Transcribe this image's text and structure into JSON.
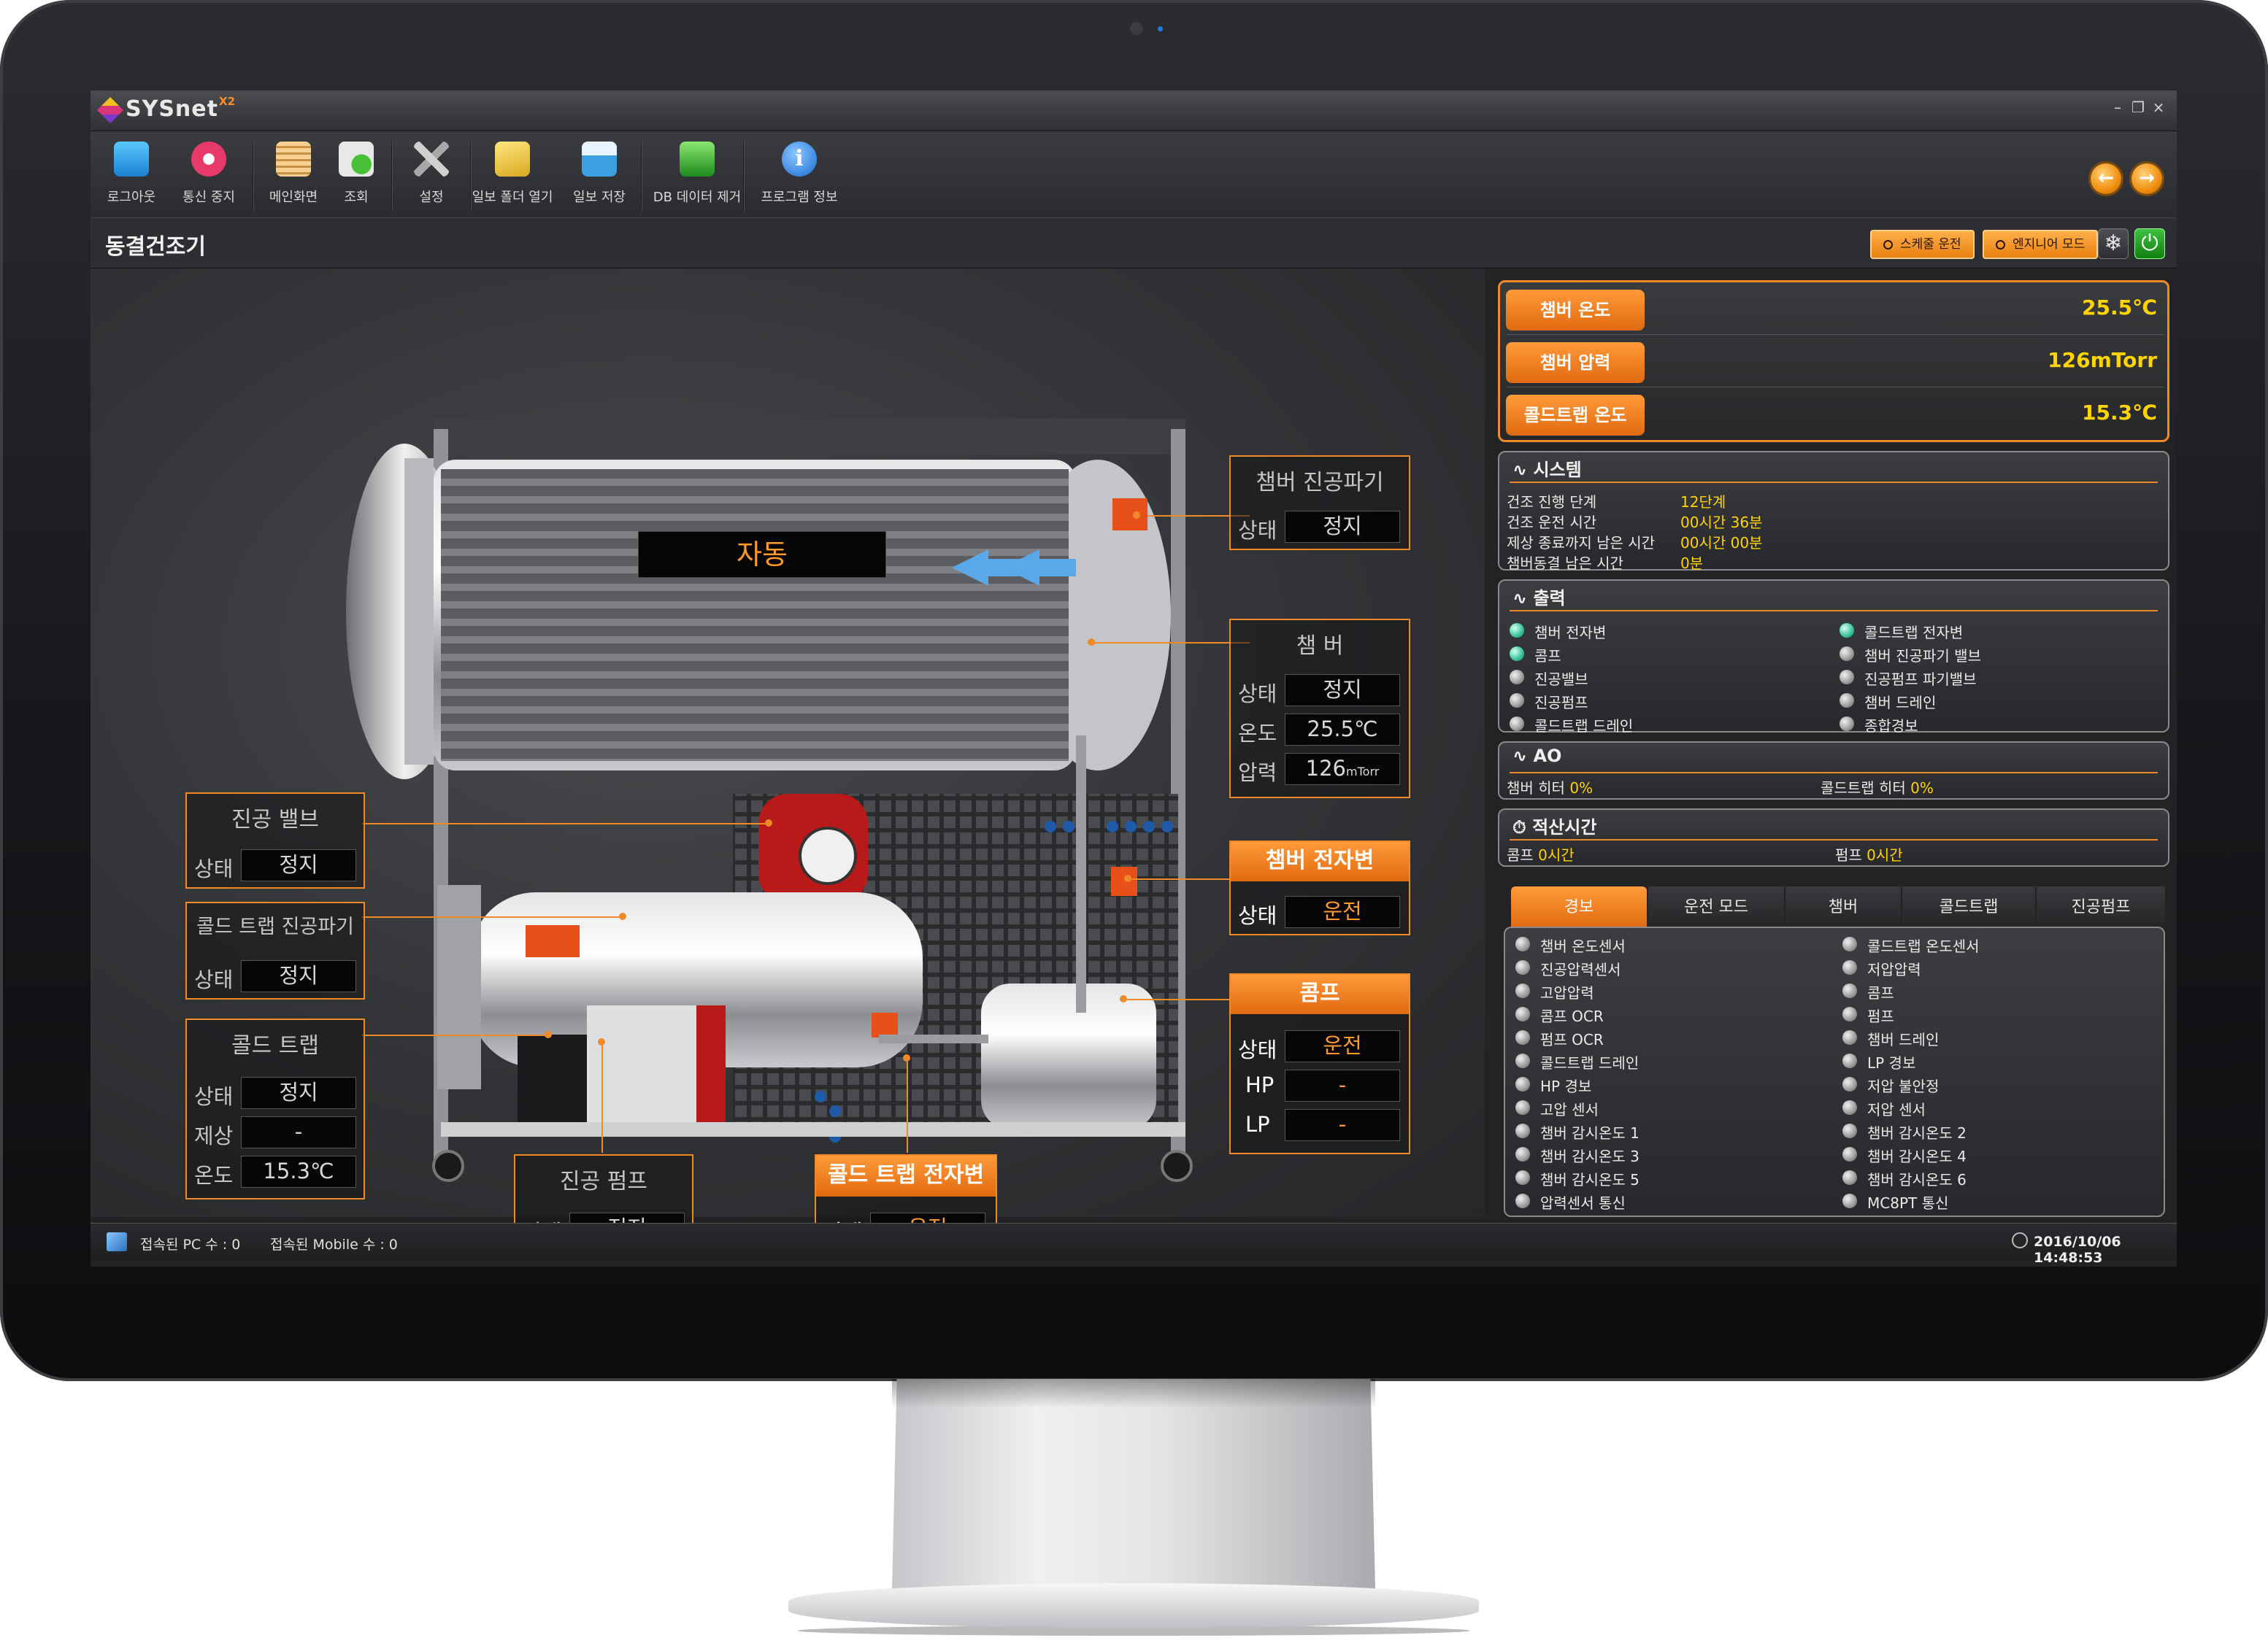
{
  "app": {
    "logo": "SYSnet",
    "logo_sup": "X2"
  },
  "toolbar": {
    "items": [
      {
        "id": "logout",
        "label": "로그아웃",
        "icon": "logout-icon",
        "color": "#2aa0e8"
      },
      {
        "id": "comm-stop",
        "label": "통신 중지",
        "icon": "stop-icon",
        "color": "#e83a6a"
      },
      {
        "id": "main",
        "label": "메인화면",
        "icon": "main-screen-icon",
        "color": "#e8a040"
      },
      {
        "id": "view",
        "label": "조회",
        "icon": "search-icon",
        "color": "#38b030"
      },
      {
        "id": "settings",
        "label": "설정",
        "icon": "tools-icon",
        "color": "#c8c8c8"
      },
      {
        "id": "open-log",
        "label": "일보 폴더 열기",
        "icon": "folder-icon",
        "color": "#e8c030"
      },
      {
        "id": "save-log",
        "label": "일보 저장",
        "icon": "save-icon",
        "color": "#3aa0e0"
      },
      {
        "id": "db-remove",
        "label": "DB 데이터 제거",
        "icon": "database-icon",
        "color": "#30a830"
      },
      {
        "id": "about",
        "label": "프로그램 정보",
        "icon": "info-icon",
        "color": "#2a8ae8"
      }
    ]
  },
  "page": {
    "title": "동결건조기"
  },
  "modes": {
    "schedule": "스케줄 운전",
    "engineer": "엔지니어 모드"
  },
  "machine": {
    "auto_label": "자동",
    "chamber_vac_break": {
      "title": "챔버 진공파기",
      "state_label": "상태",
      "state": "정지"
    },
    "chamber": {
      "title": "챔 버",
      "state_label": "상태",
      "state": "정지",
      "temp_label": "온도",
      "temp": "25.5℃",
      "pressure_label": "압력",
      "pressure": "126",
      "pressure_unit": "mTorr"
    },
    "chamber_solenoid": {
      "title": "챔버 전자변",
      "state_label": "상태",
      "state": "운전"
    },
    "compressor": {
      "title": "콤프",
      "state_label": "상태",
      "state": "운전",
      "hp_label": "HP",
      "hp": "-",
      "lp_label": "LP",
      "lp": "-"
    },
    "vacuum_valve": {
      "title": "진공 밸브",
      "state_label": "상태",
      "state": "정지"
    },
    "cold_trap_vac_break": {
      "title": "콜드 트랩 진공파기",
      "state_label": "상태",
      "state": "정지"
    },
    "cold_trap": {
      "title": "콜드 트랩",
      "state_label": "상태",
      "state": "정지",
      "defrost_label": "제상",
      "defrost": "-",
      "temp_label": "온도",
      "temp": "15.3℃"
    },
    "vacuum_pump": {
      "title": "진공 펌프",
      "state_label": "상태",
      "state": "정지"
    },
    "cold_trap_solenoid": {
      "title": "콜드 트랩 전자변",
      "state_label": "상태",
      "state": "운전"
    }
  },
  "readings": [
    {
      "label": "챔버 온도",
      "value": "25.5℃"
    },
    {
      "label": "챔버 압력",
      "value": "126mTorr"
    },
    {
      "label": "콜드트랩 온도",
      "value": "15.3℃"
    }
  ],
  "system": {
    "title": "시스템",
    "rows": [
      {
        "label": "건조 진행 단계",
        "value": "12단계"
      },
      {
        "label": "건조 운전 시간",
        "value": "00시간 36분"
      },
      {
        "label": "제상 종료까지 남은 시간",
        "value": "00시간 00분"
      },
      {
        "label": "챔버동결 남은 시간",
        "value": "0분"
      }
    ]
  },
  "output": {
    "title": "출력",
    "left": [
      {
        "label": "챔버 전자변",
        "on": true
      },
      {
        "label": "콤프",
        "on": true
      },
      {
        "label": "진공밸브",
        "on": false
      },
      {
        "label": "진공펌프",
        "on": false
      },
      {
        "label": "콜드트랩 드레인",
        "on": false
      }
    ],
    "right": [
      {
        "label": "콜드트랩 전자변",
        "on": true
      },
      {
        "label": "챔버 진공파기 밸브",
        "on": false
      },
      {
        "label": "진공펌프 파기밸브",
        "on": false
      },
      {
        "label": "챔버 드레인",
        "on": false
      },
      {
        "label": "종합경보",
        "on": false
      }
    ]
  },
  "ao": {
    "title": "AO",
    "items": [
      {
        "label": "챔버 히터",
        "value": "0%"
      },
      {
        "label": "콜드트랩 히터",
        "value": "0%"
      }
    ]
  },
  "runtime": {
    "title": "적산시간",
    "items": [
      {
        "label": "콤프",
        "value": "0시간"
      },
      {
        "label": "펌프",
        "value": "0시간"
      }
    ]
  },
  "tabs": [
    "경보",
    "운전 모드",
    "챔버",
    "콜드트랩",
    "진공펌프"
  ],
  "alarms": {
    "left": [
      "챔버 온도센서",
      "진공압력센서",
      "고압압력",
      "콤프 OCR",
      "펌프 OCR",
      "콜드트랩 드레인",
      "HP 경보",
      "고압 센서",
      "챔버 감시온도 1",
      "챔버 감시온도 3",
      "챔버 감시온도 5",
      "압력센서 통신"
    ],
    "right": [
      "콜드트랩 온도센서",
      "저압압력",
      "콤프",
      "펌프",
      "챔버 드레인",
      "LP 경보",
      "저압 불안정",
      "저압 센서",
      "챔버 감시온도 2",
      "챔버 감시온도 4",
      "챔버 감시온도 6",
      "MC8PT 통신"
    ]
  },
  "status": {
    "pc": "접속된 PC 수 : 0",
    "mobile": "접속된 Mobile 수 : 0",
    "datetime": "2016/10/06 14:48:53"
  },
  "colors": {
    "accent": "#f08a28",
    "value_yellow": "#ffd400",
    "led_on": "#40c8a0"
  }
}
